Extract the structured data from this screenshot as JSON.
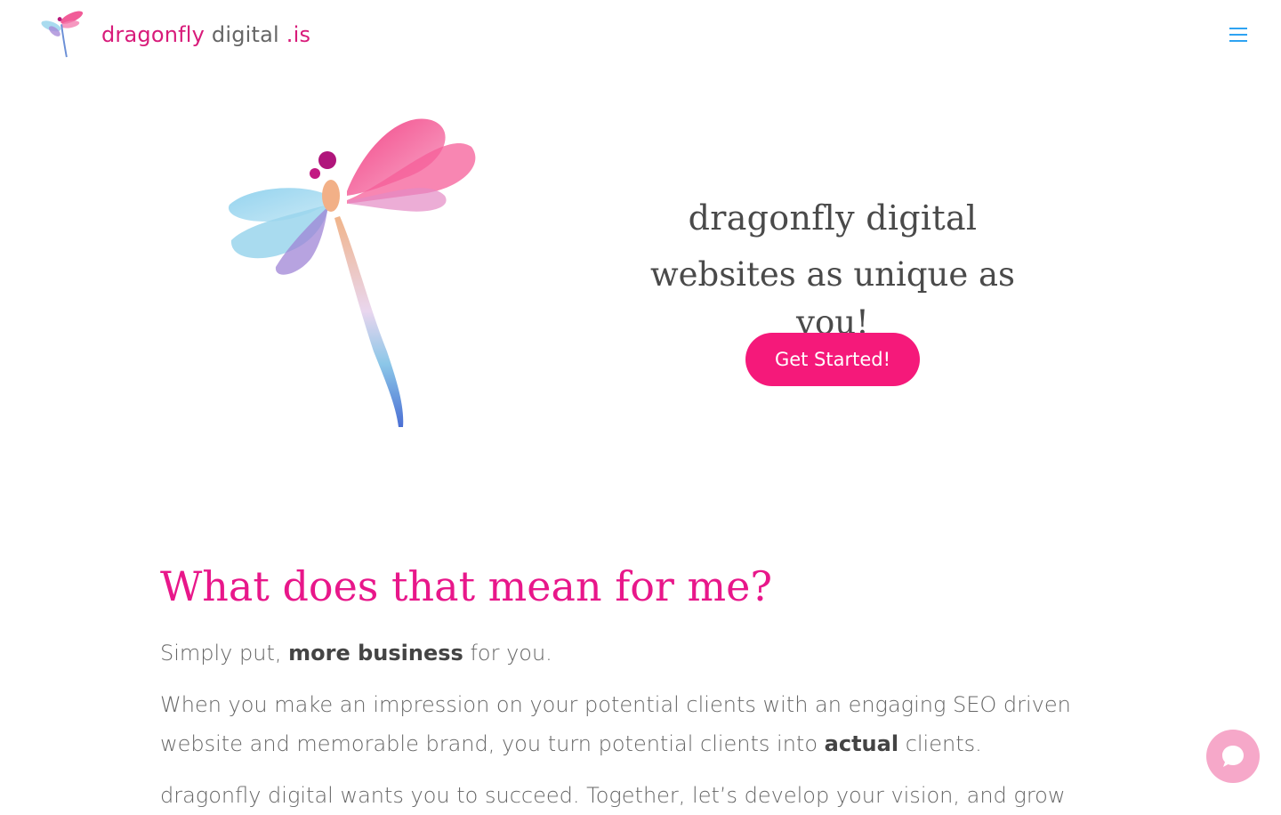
{
  "header": {
    "logo_word1": "dragonfly",
    "logo_word2": "digital",
    "logo_word3": ".is",
    "menu_icon": "hamburger-menu-icon"
  },
  "hero": {
    "line1": "dragonfly digital",
    "line2": "websites as unique as you!",
    "cta_label": "Get Started!"
  },
  "content": {
    "title": "What does that mean for me?",
    "p1_pre": "Simply put, ",
    "p1_bold": "more business",
    "p1_post": " for you.",
    "p2_pre": "When you make an impression on your potential clients with an engaging SEO driven website and memorable brand, you turn potential clients into ",
    "p2_bold": "actual",
    "p2_post": " clients.",
    "p3": "dragonfly digital wants you to succeed. Together, let’s develop your vision, and grow"
  },
  "chat": {
    "icon": "chat-bubble-icon"
  },
  "colors": {
    "brand_pink": "#e8178a",
    "cta_pink": "#f5197a",
    "menu_blue": "#2ea3f2",
    "chat_pink": "#f6a8c9"
  }
}
